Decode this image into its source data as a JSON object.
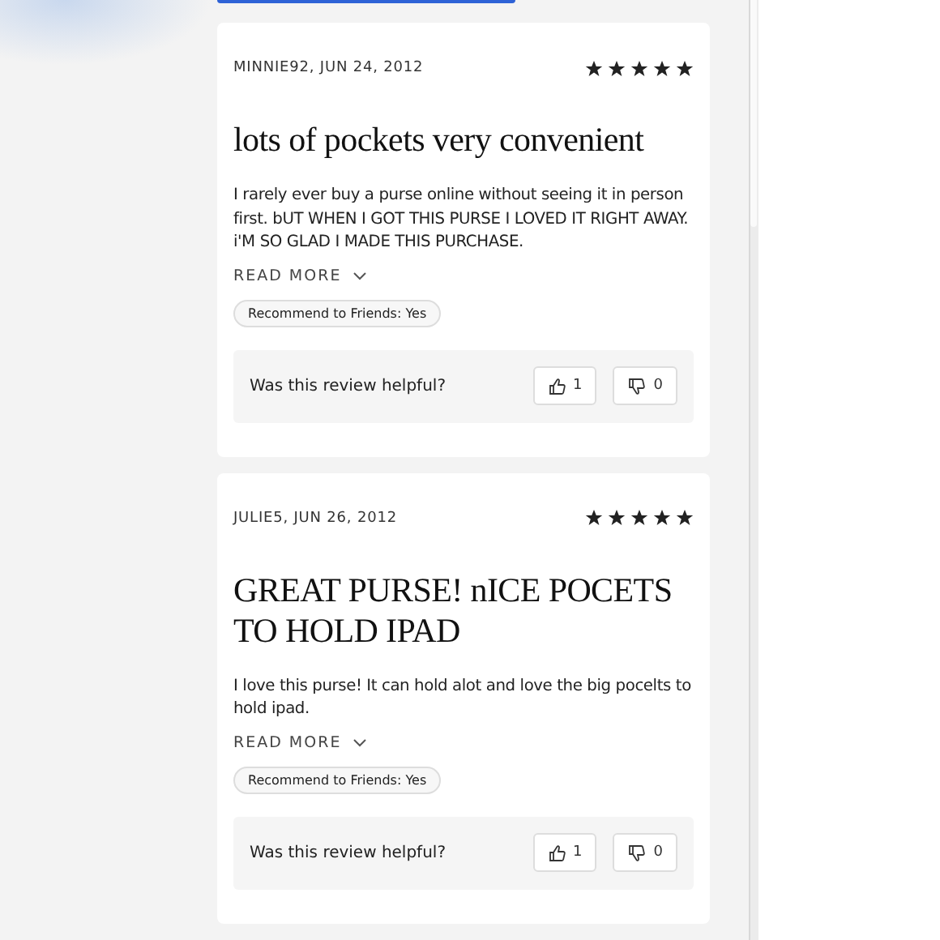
{
  "reviews": [
    {
      "author_date": "MINNIE92, JUN 24, 2012",
      "stars": 5,
      "title": "lots of pockets very convenient",
      "body": "I rarely ever buy a purse online without seeing it in person first. bUT WHEN I GOT THIS PURSE I LOVED IT RIGHT AWAY. i'M SO GLAD I MADE THIS PURCHASE.",
      "read_more": "READ MORE",
      "recommend": "Recommend to Friends: Yes",
      "helpful_prompt": "Was this review helpful?",
      "helpful_yes": "1",
      "helpful_no": "0"
    },
    {
      "author_date": "JULIE5, JUN 26, 2012",
      "stars": 5,
      "title": "GREAT PURSE! nICE POCETS TO HOLD IPAD",
      "body": "I love this purse! It can hold alot and love the big pocelts to hold ipad.",
      "read_more": "READ MORE",
      "recommend": "Recommend to Friends: Yes",
      "helpful_prompt": "Was this review helpful?",
      "helpful_yes": "1",
      "helpful_no": "0"
    }
  ]
}
